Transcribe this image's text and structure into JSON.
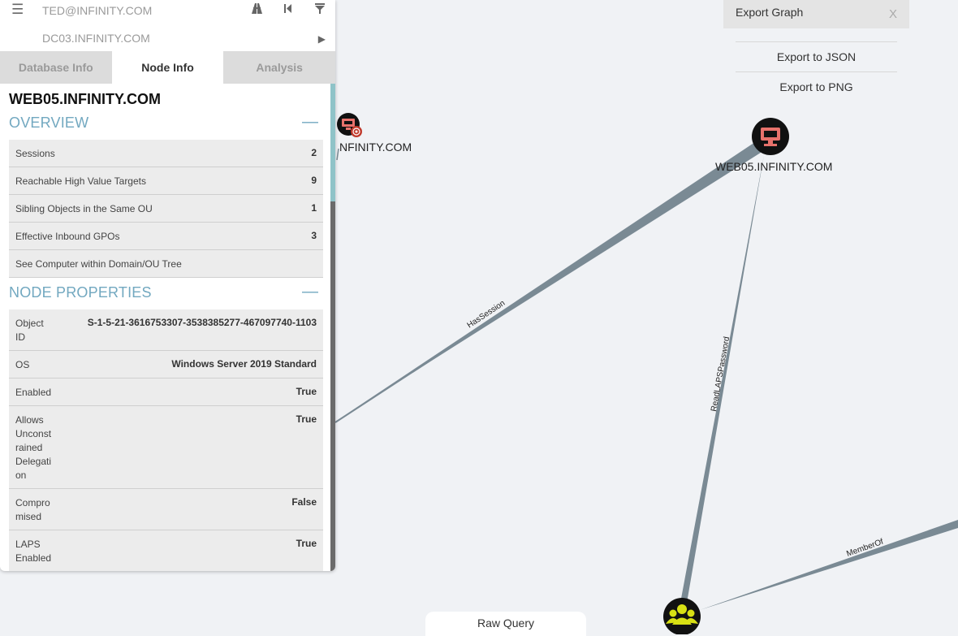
{
  "search": {
    "start_node": "TED@INFINITY.COM",
    "end_node": "DC03.INFINITY.COM"
  },
  "icons": {
    "menu": "hamburger-icon",
    "pathfinding": "pathfinding-icon",
    "back": "back-icon",
    "filter": "filter-icon",
    "play": "play-icon"
  },
  "tabs": [
    {
      "label": "Database Info",
      "active": false
    },
    {
      "label": "Node Info",
      "active": true
    },
    {
      "label": "Analysis",
      "active": false
    }
  ],
  "node_info": {
    "title": "WEB05.INFINITY.COM",
    "overview": {
      "header": "OVERVIEW",
      "collapse": "—",
      "rows": [
        {
          "label": "Sessions",
          "value": "2"
        },
        {
          "label": "Reachable High Value Targets",
          "value": "9"
        },
        {
          "label": "Sibling Objects in the Same OU",
          "value": "1"
        },
        {
          "label": "Effective Inbound GPOs",
          "value": "3"
        },
        {
          "label": "See Computer within Domain/OU Tree",
          "value": ""
        }
      ]
    },
    "properties": {
      "header": "NODE PROPERTIES",
      "collapse": "—",
      "rows": [
        {
          "label": "Object\nID",
          "value": "S-1-5-21-3616753307-3538385277-467097740-1103"
        },
        {
          "label": "OS",
          "value": "Windows Server 2019 Standard"
        },
        {
          "label": "Enabled",
          "value": "True"
        },
        {
          "label": "Allows\nUnconst\nrained\nDelegati\non",
          "value": "True"
        },
        {
          "label": "Compro\nmised",
          "value": "False"
        },
        {
          "label": "LAPS\nEnabled",
          "value": "True"
        }
      ]
    }
  },
  "export": {
    "title": "Export Graph",
    "close": "X",
    "items": [
      "Export to JSON",
      "Export to PNG"
    ]
  },
  "raw_query": {
    "label": "Raw Query"
  },
  "graph": {
    "nodes": [
      {
        "label": "WEB05.INFINITY.COM",
        "type": "computer-icon"
      },
      {
        "label": "NFINITY.COM",
        "type": "computer-icon"
      },
      {
        "label": "",
        "type": "group-icon"
      }
    ],
    "edges": [
      {
        "label": "HasSession"
      },
      {
        "label": "ReadLAPSPassword"
      },
      {
        "label": "MemberOf"
      }
    ]
  },
  "colors": {
    "computer_node": "#111111",
    "computer_glyph": "#e8726c",
    "group_node": "#111111",
    "group_glyph": "#d8e014",
    "edge": "#7a8a94",
    "section_header": "#72a8c0",
    "background": "#f0f2f5"
  }
}
